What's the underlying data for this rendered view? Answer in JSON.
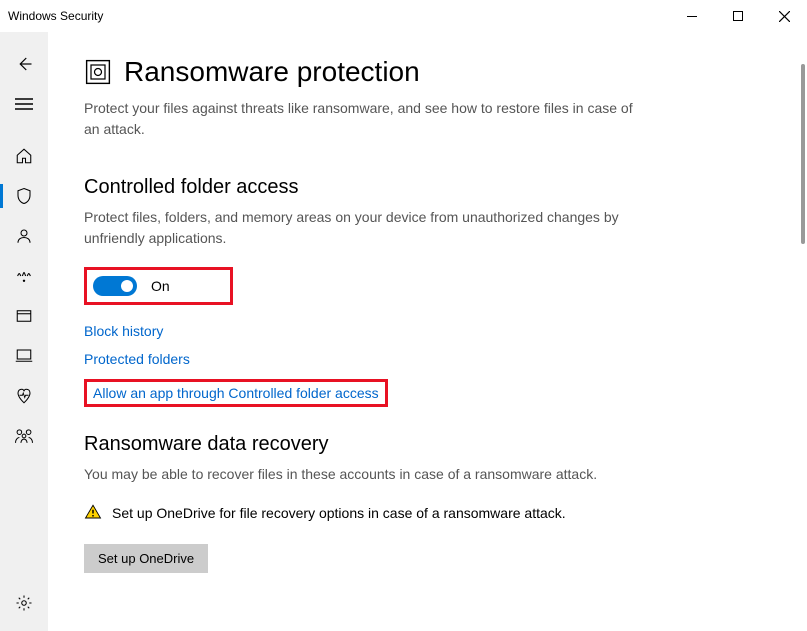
{
  "window": {
    "title": "Windows Security"
  },
  "sidebar": {
    "items": [
      {
        "name": "back"
      },
      {
        "name": "menu"
      },
      {
        "name": "home"
      },
      {
        "name": "virus"
      },
      {
        "name": "account"
      },
      {
        "name": "firewall"
      },
      {
        "name": "app-browser"
      },
      {
        "name": "device-security"
      },
      {
        "name": "performance"
      },
      {
        "name": "family"
      },
      {
        "name": "settings"
      }
    ]
  },
  "page": {
    "title": "Ransomware protection",
    "description": "Protect your files against threats like ransomware, and see how to restore files in case of an attack."
  },
  "controlled": {
    "title": "Controlled folder access",
    "description": "Protect files, folders, and memory areas on your device from unauthorized changes by unfriendly applications.",
    "toggle_state": "On",
    "link_block_history": "Block history",
    "link_protected_folders": "Protected folders",
    "link_allow_app": "Allow an app through Controlled folder access"
  },
  "recovery": {
    "title": "Ransomware data recovery",
    "description": "You may be able to recover files in these accounts in case of a ransomware attack.",
    "alert": "Set up OneDrive for file recovery options in case of a ransomware attack.",
    "button": "Set up OneDrive"
  }
}
